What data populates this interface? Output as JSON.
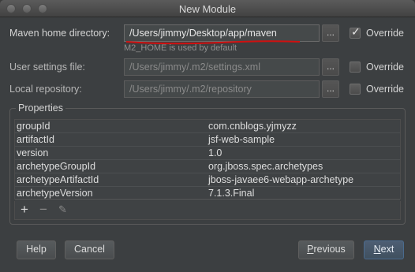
{
  "window": {
    "title": "New Module"
  },
  "maven_home": {
    "label": "Maven home directory:",
    "value": "/Users/jimmy/Desktop/app/maven",
    "browse": "...",
    "override_label": "Override",
    "override_checked": true,
    "hint": "M2_HOME is used by default"
  },
  "user_settings": {
    "label": "User settings file:",
    "value": "/Users/jimmy/.m2/settings.xml",
    "browse": "...",
    "override_label": "Override",
    "override_checked": false
  },
  "local_repo": {
    "label": "Local repository:",
    "value": "/Users/jimmy/.m2/repository",
    "browse": "...",
    "override_label": "Override",
    "override_checked": false
  },
  "properties": {
    "title": "Properties",
    "rows": [
      {
        "key": "groupId",
        "value": "com.cnblogs.yjmyzz"
      },
      {
        "key": "artifactId",
        "value": "jsf-web-sample"
      },
      {
        "key": "version",
        "value": "1.0"
      },
      {
        "key": "archetypeGroupId",
        "value": "org.jboss.spec.archetypes"
      },
      {
        "key": "archetypeArtifactId",
        "value": "jboss-javaee6-webapp-archetype"
      },
      {
        "key": "archetypeVersion",
        "value": "7.1.3.Final"
      }
    ],
    "toolbar": {
      "add": "+",
      "remove": "−",
      "edit": "✎"
    }
  },
  "buttons": {
    "help": "Help",
    "cancel": "Cancel",
    "previous_mnemonic": "P",
    "previous_rest": "revious",
    "next_mnemonic": "N",
    "next_rest": "ext"
  },
  "colors": {
    "annotation": "#d01010",
    "check": "#e8e8e8"
  }
}
